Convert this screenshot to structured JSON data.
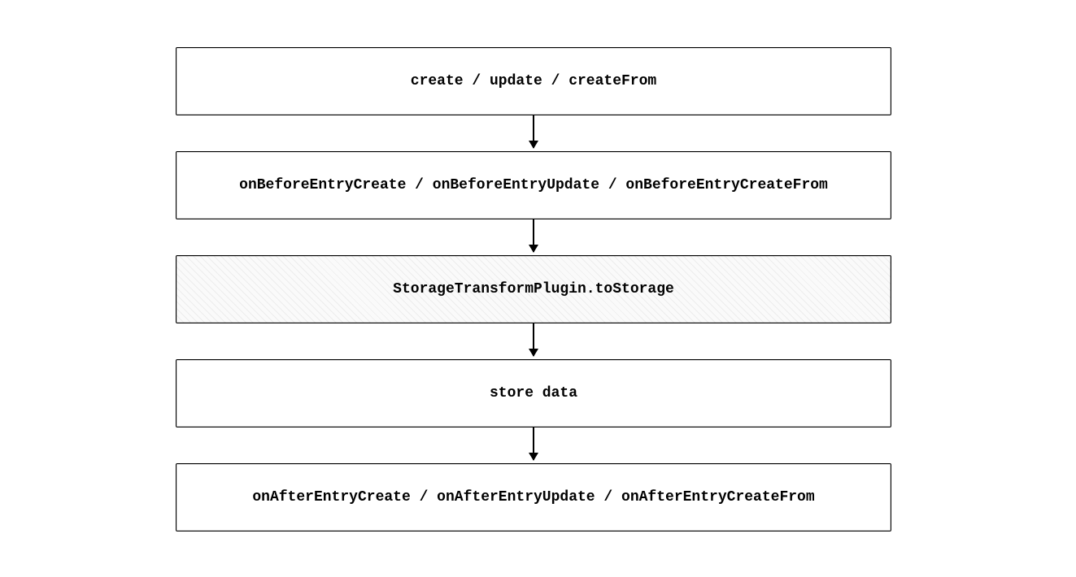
{
  "diagram": {
    "boxes": [
      {
        "label": "create / update / createFrom",
        "hatched": false
      },
      {
        "label": "onBeforeEntryCreate / onBeforeEntryUpdate / onBeforeEntryCreateFrom",
        "hatched": false
      },
      {
        "label": "StorageTransformPlugin.toStorage",
        "hatched": true
      },
      {
        "label": "store data",
        "hatched": false
      },
      {
        "label": "onAfterEntryCreate / onAfterEntryUpdate / onAfterEntryCreateFrom",
        "hatched": false
      }
    ]
  }
}
